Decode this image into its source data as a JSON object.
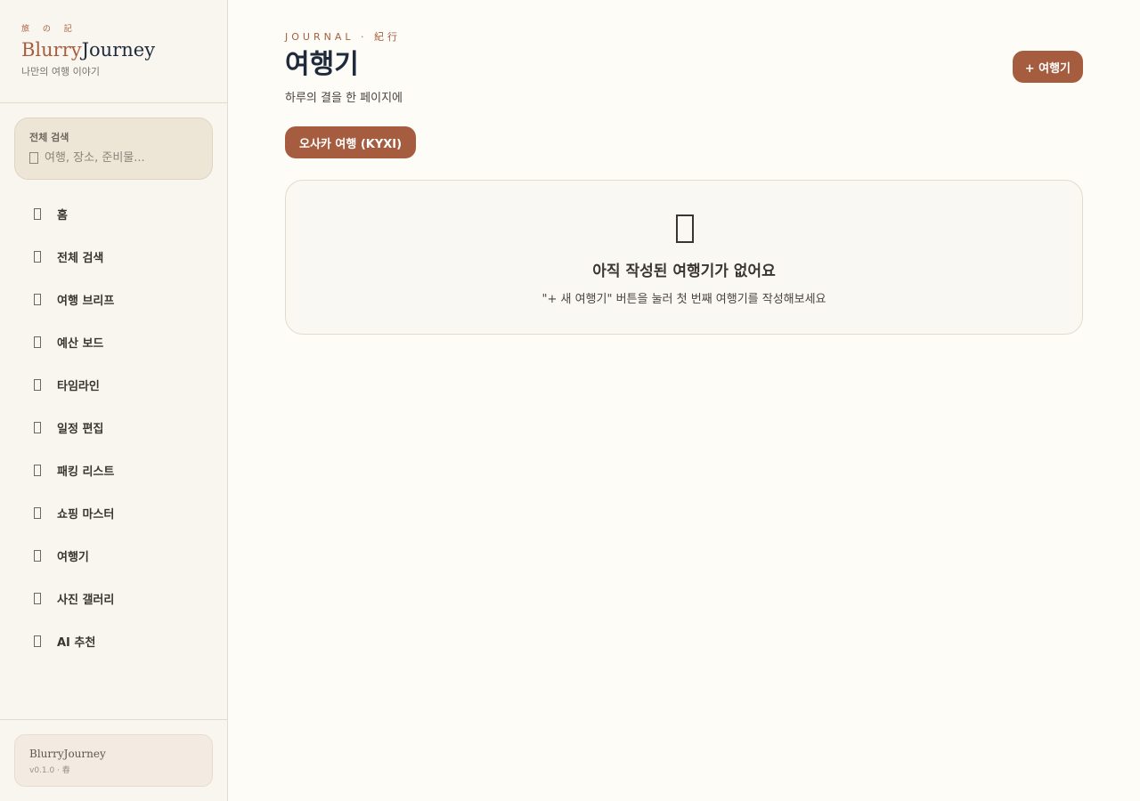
{
  "sidebar": {
    "brand": {
      "kanji": "旅 の 記",
      "title_accent": "Blurry",
      "title_rest": "Journey",
      "subtitle": "나만의 여행 이야기"
    },
    "search": {
      "label": "전체 검색",
      "placeholder": "여행, 장소, 준비물...",
      "icon": "search-icon"
    },
    "items": [
      {
        "label": "홈",
        "icon": "home-icon"
      },
      {
        "label": "전체 검색",
        "icon": "search-icon"
      },
      {
        "label": "여행 브리프",
        "icon": "brief-icon"
      },
      {
        "label": "예산 보드",
        "icon": "budget-icon"
      },
      {
        "label": "타임라인",
        "icon": "timeline-icon"
      },
      {
        "label": "일정 편집",
        "icon": "calendar-icon"
      },
      {
        "label": "패킹 리스트",
        "icon": "luggage-icon"
      },
      {
        "label": "쇼핑 마스터",
        "icon": "shopping-icon"
      },
      {
        "label": "여행기",
        "icon": "journal-icon"
      },
      {
        "label": "사진 갤러리",
        "icon": "photo-icon"
      },
      {
        "label": "AI 추천",
        "icon": "sparkle-icon"
      }
    ],
    "footer": {
      "name": "BlurryJourney",
      "version": "v0.1.0 · 春"
    }
  },
  "main": {
    "kicker": "JOURNAL · 紀行",
    "title": "여행기",
    "subtitle": "하루의 결을 한 페이지에",
    "new_button": "+ 여행기",
    "trip_chip": "오사카 여행 (KYXI)",
    "empty": {
      "icon": "notebook-icon",
      "title": "아직 작성된 여행기가 없어요",
      "description": "\"+ 새 여행기\" 버튼을 눌러 첫 번째 여행기를 작성해보세요"
    }
  },
  "colors": {
    "accent": "#a65d3f",
    "heading": "#1f2a3d",
    "sidebar_bg": "#f9f6ef",
    "page_bg": "#fefcf7"
  }
}
